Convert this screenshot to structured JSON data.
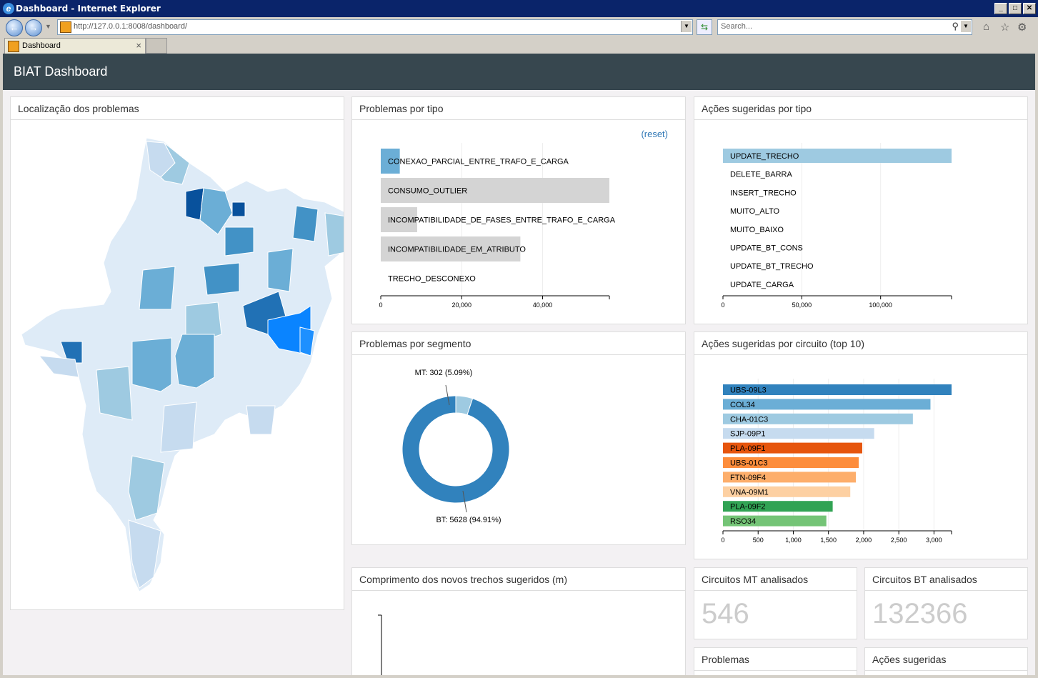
{
  "window": {
    "title": "Dashboard - Internet Explorer",
    "url_host": "http://127.0.0.1",
    "url_rest": ":8008/dashboard/",
    "search_placeholder": "Search...",
    "tab_label": "Dashboard"
  },
  "app": {
    "brand": "BIAT Dashboard"
  },
  "panels": {
    "map_title": "Localização dos problemas",
    "tipo_title": "Problemas por tipo",
    "tipo_reset": "(reset)",
    "acoes_tipo_title": "Ações sugeridas por tipo",
    "segmento_title": "Problemas por segmento",
    "circuito_title": "Ações sugeridas por circuito (top 10)",
    "comprimento_title": "Comprimento dos novos trechos sugeridos (m)",
    "mt_title": "Circuitos MT analisados",
    "mt_value": "546",
    "bt_title": "Circuitos BT analisados",
    "bt_value": "132366",
    "problemas_title": "Problemas",
    "acoes_title": "Ações sugeridas"
  },
  "chart_data": [
    {
      "id": "problemas-por-tipo",
      "type": "bar",
      "orientation": "horizontal",
      "categories": [
        "CONEXAO_PARCIAL_ENTRE_TRAFO_E_CARGA",
        "CONSUMO_OUTLIER",
        "INCOMPATIBILIDADE_DE_FASES_ENTRE_TRAFO_E_CARGA",
        "INCOMPATIBILIDADE_EM_ATRIBUTO",
        "TRECHO_DESCONEXO"
      ],
      "values": [
        4700,
        56500,
        9000,
        34500,
        0
      ],
      "colors": [
        "#6baed6",
        "#d4d4d4",
        "#d4d4d4",
        "#d4d4d4",
        "#d4d4d4"
      ],
      "xlim": [
        0,
        56500
      ],
      "xticks": [
        0,
        20000,
        40000
      ],
      "xtick_labels": [
        "0",
        "20,000",
        "40,000"
      ]
    },
    {
      "id": "acoes-por-tipo",
      "type": "bar",
      "orientation": "horizontal",
      "categories": [
        "UPDATE_TRECHO",
        "DELETE_BARRA",
        "INSERT_TRECHO",
        "MUITO_ALTO",
        "MUITO_BAIXO",
        "UPDATE_BT_CONS",
        "UPDATE_BT_TRECHO",
        "UPDATE_CARGA"
      ],
      "values": [
        145000,
        0,
        0,
        0,
        0,
        0,
        0,
        0
      ],
      "colors": [
        "#9ecae1",
        "#9ecae1",
        "#9ecae1",
        "#9ecae1",
        "#9ecae1",
        "#9ecae1",
        "#9ecae1",
        "#9ecae1"
      ],
      "xlim": [
        0,
        145000
      ],
      "xticks": [
        0,
        50000,
        100000
      ],
      "xtick_labels": [
        "0",
        "50,000",
        "100,000"
      ]
    },
    {
      "id": "problemas-por-segmento",
      "type": "pie",
      "labels": [
        "MT: 302 (5.09%)",
        "BT: 5628 (94.91%)"
      ],
      "values": [
        302,
        5628
      ],
      "colors": [
        "#9ecae1",
        "#3182bd"
      ]
    },
    {
      "id": "acoes-por-circuito",
      "type": "bar",
      "orientation": "horizontal",
      "categories": [
        "UBS-09L3",
        "COL34",
        "CHA-01C3",
        "SJP-09P1",
        "PLA-09F1",
        "UBS-01C3",
        "FTN-09F4",
        "VNA-09M1",
        "PLA-09F2",
        "RSO34"
      ],
      "values": [
        3250,
        2950,
        2700,
        2150,
        1980,
        1930,
        1890,
        1810,
        1560,
        1470
      ],
      "colors": [
        "#3182bd",
        "#6baed6",
        "#9ecae1",
        "#c6dbef",
        "#e6550d",
        "#fd8d3c",
        "#fdae6b",
        "#fdd0a2",
        "#31a354",
        "#74c476"
      ],
      "xlim": [
        0,
        3250
      ],
      "xticks": [
        0,
        500,
        1000,
        1500,
        2000,
        2500,
        3000
      ],
      "xtick_labels": [
        "0",
        "500",
        "1,000",
        "1,500",
        "2,000",
        "2,500",
        "3,000"
      ]
    }
  ]
}
